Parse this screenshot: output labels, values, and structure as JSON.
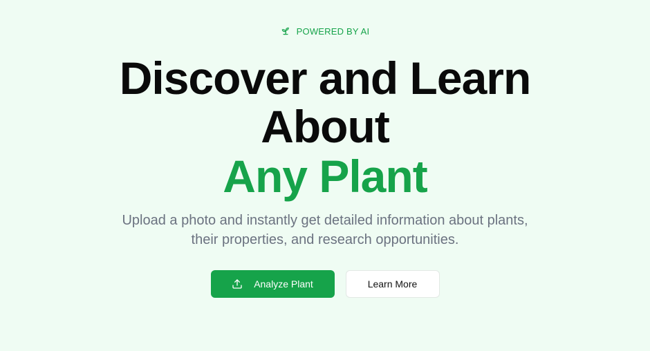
{
  "badge": {
    "icon": "sprout-icon",
    "label": "POWERED BY AI"
  },
  "headline": {
    "line1": "Discover and Learn",
    "line2": "About",
    "line3": "Any Plant"
  },
  "subtitle": {
    "line1": "Upload a photo and instantly get detailed information about plants,",
    "line2": "their properties, and research opportunities."
  },
  "actions": {
    "primary": {
      "icon": "upload-icon",
      "label": "Analyze Plant"
    },
    "secondary": {
      "label": "Learn More"
    }
  },
  "colors": {
    "background": "#effcf3",
    "accent": "#16a34a",
    "heading": "#0a0a0a",
    "muted": "#6b7280"
  }
}
